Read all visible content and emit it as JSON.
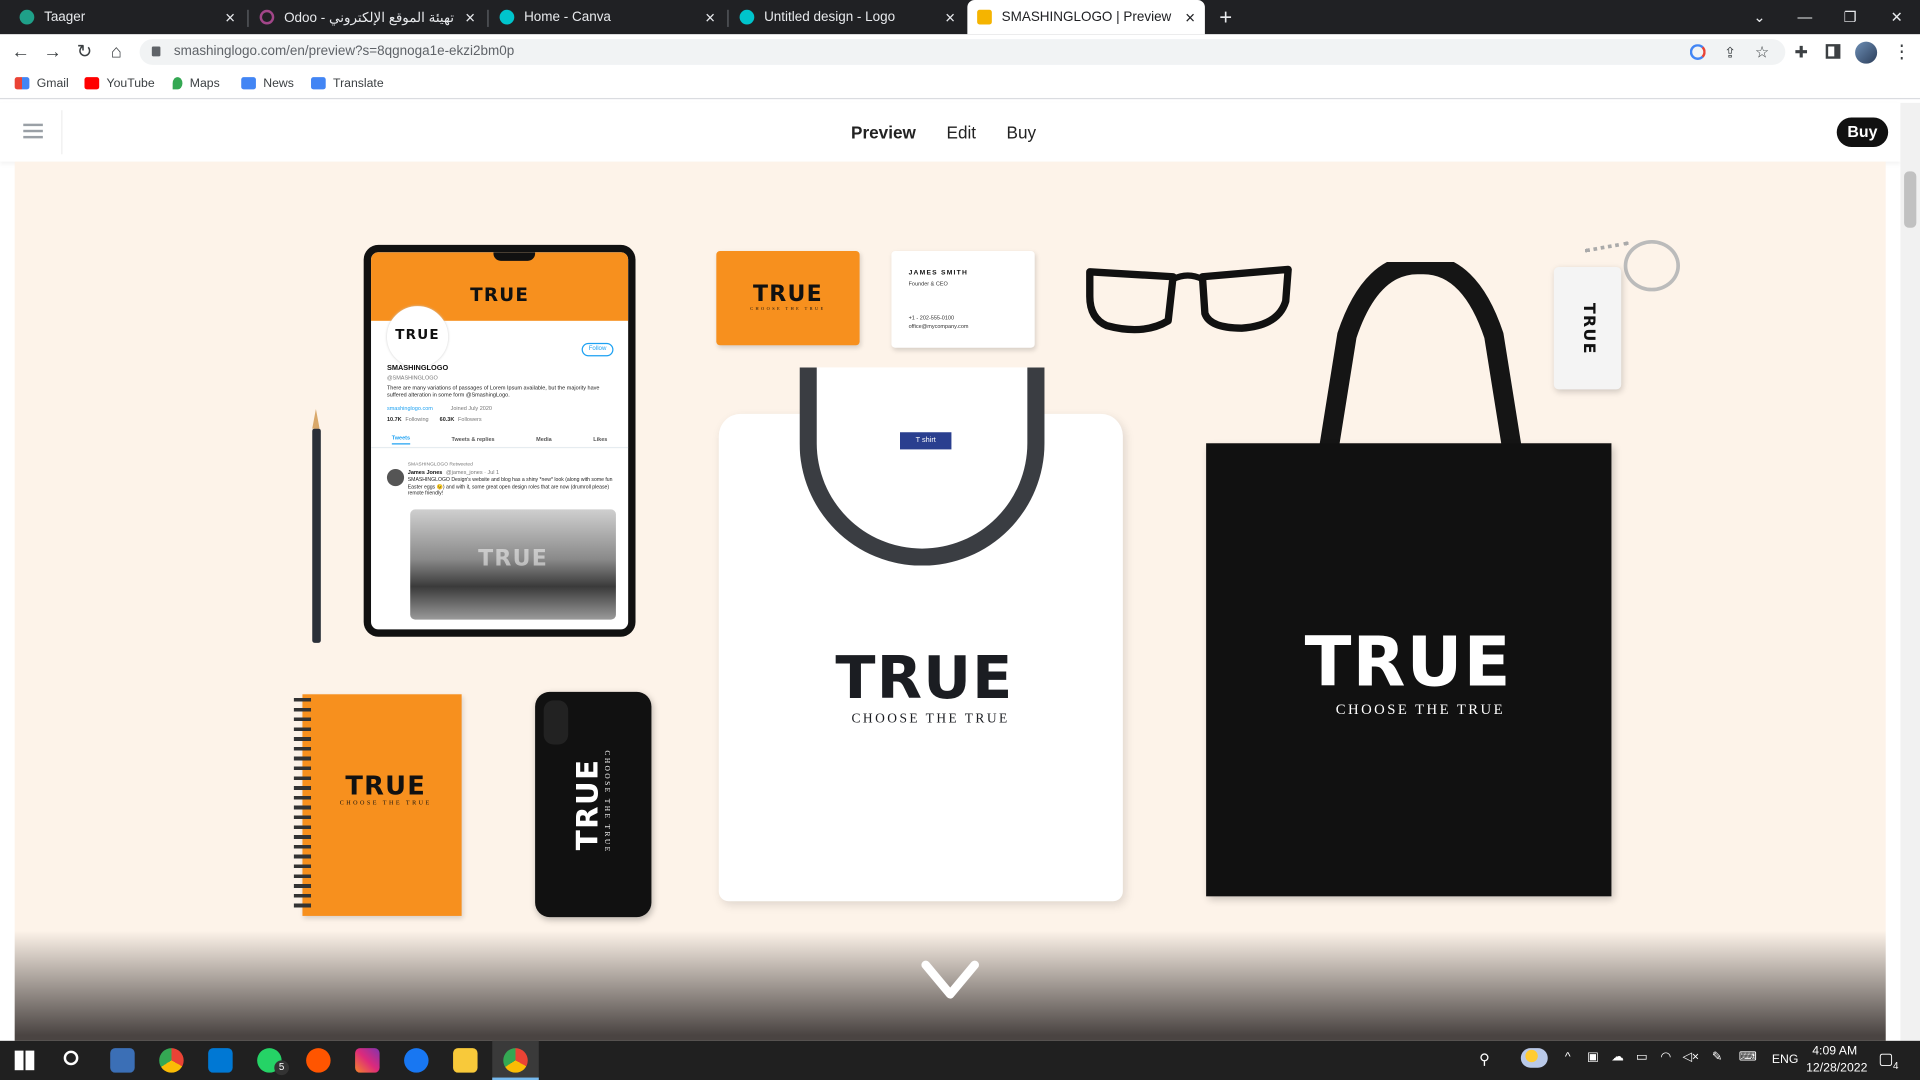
{
  "browser": {
    "tabs": [
      {
        "title": "Taager",
        "color": "#1fa089"
      },
      {
        "title": "Odoo - أداة تهيئة الموقع الإلكتروني",
        "color": "#a24689"
      },
      {
        "title": "Home - Canva",
        "color": "#00c4cc"
      },
      {
        "title": "Untitled design - Logo",
        "color": "#00c4cc"
      },
      {
        "title": "SMASHINGLOGO | Preview",
        "color": "#f5b400"
      }
    ],
    "url": "smashinglogo.com/en/preview?s=8qgnoga1e-ekzi2bm0p",
    "bookmarks": [
      "Gmail",
      "YouTube",
      "Maps",
      "News",
      "Translate"
    ]
  },
  "site": {
    "nav": [
      "Preview",
      "Edit",
      "Buy"
    ],
    "buy_button": "Buy",
    "brand": {
      "name": "TRUE",
      "tagline": "CHOOSE THE TRUE",
      "accent": "#f7901e"
    }
  },
  "mockups": {
    "tablet": {
      "profile_name": "SMASHINGLOGO",
      "handle": "@SMASHINGLOGO",
      "bio": "There are many variations of passages of Lorem Ipsum available, but the majority have suffered alteration in some form @SmashingLogo.",
      "link": "smashinglogo.com",
      "joined": "Joined July 2020",
      "following": "10.7K",
      "following_label": "Following",
      "followers": "60.3K",
      "followers_label": "Followers",
      "follow_button": "Follow",
      "tabs": [
        "Tweets",
        "Tweets & replies",
        "Media",
        "Likes"
      ],
      "retweet_label": "SMASHINGLOGO Retweeted",
      "tweet_author": "James Jones",
      "tweet_meta": "@james_jones · Jul 1",
      "tweet_text": "SMASHINGLOGO Design's website and blog has a shiny *new* look (along with some fun Easter eggs 😉) and with it, some great open design roles that are now (drumroll please) remote friendly!"
    },
    "business_card": {
      "name": "JAMES SMITH",
      "role": "Founder & CEO",
      "phone": "+1 - 202-555-0100",
      "email": "office@mycompany.com"
    },
    "tshirt_label": "T shirt"
  },
  "taskbar": {
    "time": "4:09 AM",
    "date": "12/28/2022",
    "lang": "ENG",
    "whatsapp_badge": "5",
    "notif_badge": "4"
  }
}
